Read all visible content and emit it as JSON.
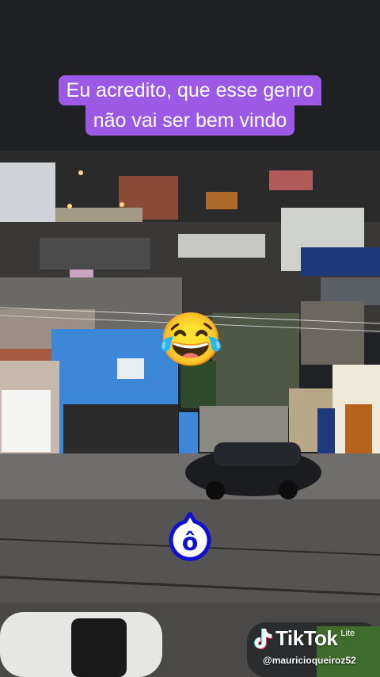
{
  "caption": {
    "line1": "Eu acredito, que esse genro",
    "line2": "não vai ser bem vindo"
  },
  "sticker": {
    "emoji": "😂",
    "name": "face-with-tears-of-joy"
  },
  "marker": {
    "letter": "ô"
  },
  "watermark": {
    "brand": "TikTok",
    "edition": "Lite",
    "handle": "@mauricioqueiroz52"
  },
  "colors": {
    "caption_bg": "#9b59e6",
    "marker_blue": "#1010d0",
    "wall_blue": "#3d87d8"
  }
}
